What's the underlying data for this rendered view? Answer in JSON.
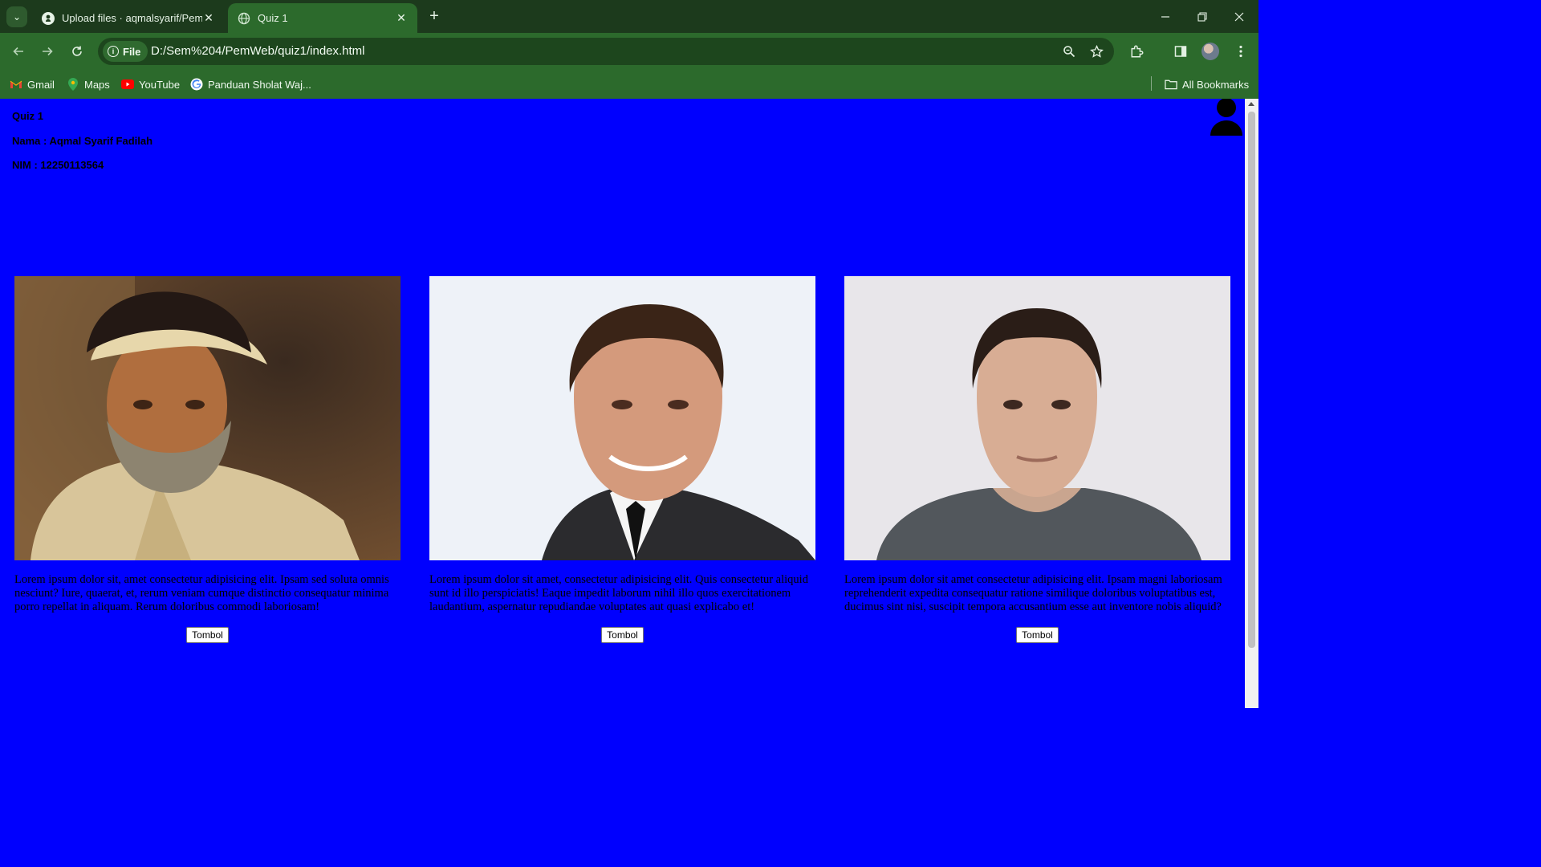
{
  "browser": {
    "tabs": [
      {
        "title": "Upload files · aqmalsyarif/Pemr",
        "close": "✕",
        "active": false
      },
      {
        "title": "Quiz 1",
        "close": "✕",
        "active": true
      }
    ],
    "new_tab": "+",
    "omnibox": {
      "chip_label": "File",
      "url": "D:/Sem%204/PemWeb/quiz1/index.html"
    },
    "bookmarks": [
      {
        "label": "Gmail",
        "icon": "gmail-icon"
      },
      {
        "label": "Maps",
        "icon": "maps-icon"
      },
      {
        "label": "YouTube",
        "icon": "youtube-icon"
      },
      {
        "label": "Panduan Sholat Waj...",
        "icon": "google-icon"
      }
    ],
    "all_bookmarks": "All Bookmarks"
  },
  "page": {
    "title": "Quiz 1",
    "nama": "Nama : Aqmal Syarif Fadilah",
    "nim": "NIM : 12250113564",
    "cards": [
      {
        "photo": "portrait-bearded-man-turban",
        "text": "Lorem ipsum dolor sit, amet consectetur adipisicing elit. Ipsam sed soluta omnis nesciunt? Iure, quaerat, et, rerum veniam cumque distinctio consequatur minima porro repellat in aliquam. Rerum doloribus commodi laboriosam!",
        "button": "Tombol"
      },
      {
        "photo": "portrait-smiling-man-suit",
        "text": "Lorem ipsum dolor sit amet, consectetur adipisicing elit. Quis consectetur aliquid sunt id illo perspiciatis! Eaque impedit laborum nihil illo quos exercitationem laudantium, aspernatur repudiandae voluptates aut quasi explicabo et!",
        "button": "Tombol"
      },
      {
        "photo": "portrait-man-grey-tshirt",
        "text": "Lorem ipsum dolor sit amet consectetur adipisicing elit. Ipsam magni laboriosam reprehenderit expedita consequatur ratione similique doloribus voluptatibus est, ducimus sint nisi, suscipit tempora accusantium esse aut inventore nobis aliquid?",
        "button": "Tombol"
      }
    ]
  },
  "colors": {
    "page_bg": "#0000fe",
    "chrome_dark": "#1c3a1c",
    "chrome": "#2c6a2c"
  }
}
